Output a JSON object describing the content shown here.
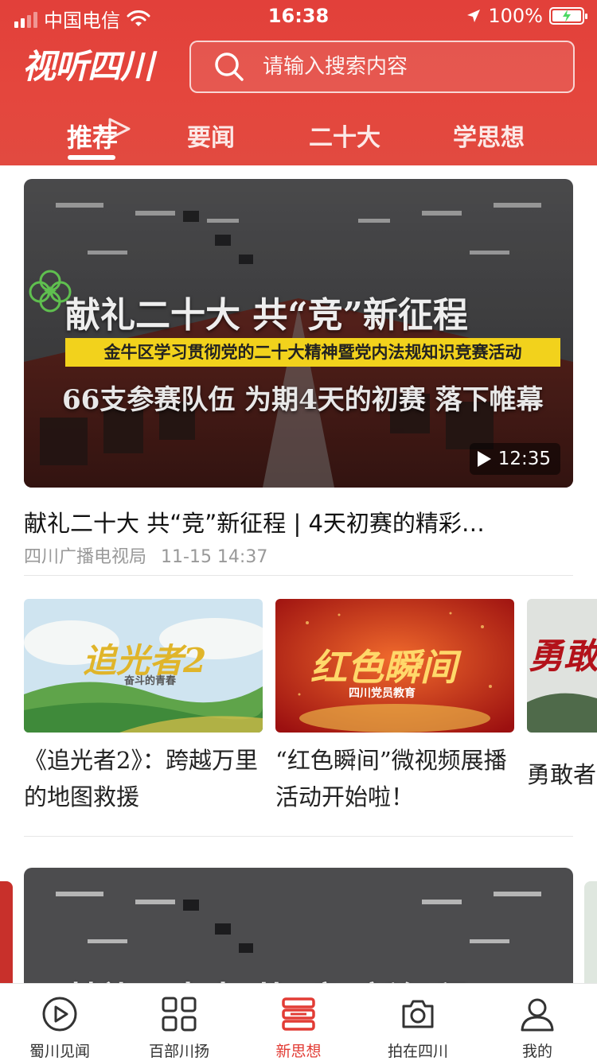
{
  "status_bar": {
    "carrier": "中国电信",
    "time": "16:38",
    "battery": "100%"
  },
  "header": {
    "logo": "视听四川",
    "search": {
      "placeholder": "请输入搜索内容"
    },
    "tabs": [
      {
        "label": "推荐",
        "active": true
      },
      {
        "label": "要闻",
        "active": false
      },
      {
        "label": "二十大",
        "active": false
      },
      {
        "label": "学思想",
        "active": false
      }
    ]
  },
  "feed": {
    "hero": {
      "overlay_title": "献礼二十大 共“竞”新征程",
      "overlay_banner": "金牛区学习贯彻党的二十大精神暨党内法规知识竞赛活动",
      "overlay_sub": "66支参赛队伍 为期4天的初赛 落下帷幕",
      "duration": "12:35",
      "title": "献礼二十大 共“竞”新征程 | 4天初赛的精彩…",
      "source": "四川广播电视局",
      "date": "11-15 14:37"
    },
    "cards": [
      {
        "thumb_text": "追光者2",
        "thumb_sub": "奋斗的青春",
        "title": "《追光者2》：跨越万里的地图救援"
      },
      {
        "thumb_text": "红色瞬间",
        "thumb_sub": "四川党员教育",
        "title": "“红色瞬间”微视频展播活动开始啦！"
      },
      {
        "thumb_text": "勇敢",
        "title": "勇敢者"
      }
    ],
    "hero2": {
      "overlay_title": "献礼二十大 共“竞”新征程"
    }
  },
  "bottom_nav": [
    {
      "label": "蜀川见闻",
      "icon": "play-circle-icon",
      "active": false
    },
    {
      "label": "百部川扬",
      "icon": "grid-icon",
      "active": false
    },
    {
      "label": "新思想",
      "icon": "book-stack-icon",
      "active": true
    },
    {
      "label": "拍在四川",
      "icon": "camera-icon",
      "active": false
    },
    {
      "label": "我的",
      "icon": "user-icon",
      "active": false
    }
  ],
  "colors": {
    "brand_red": "#e2403a",
    "banner_yellow": "#f2d21c",
    "active_nav": "#e23c35"
  }
}
